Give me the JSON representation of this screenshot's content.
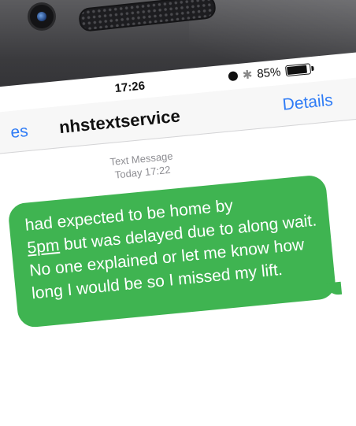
{
  "status_bar": {
    "time": "17:26",
    "battery": "85%",
    "battery_level": 0.85,
    "icons": [
      "alarm-icon",
      "bluetooth-icon",
      "battery-icon"
    ]
  },
  "nav": {
    "back_label": "es",
    "title": "nhstextservice",
    "details_label": "Details"
  },
  "thread": {
    "meta_type": "Text Message",
    "meta_time": "Today 17:22"
  },
  "message": {
    "text_prefix": "had expected to be home by",
    "link_text": "5pm",
    "text_suffix": " but was delayed due to along wait. No one explained or let me know how long I would be so I missed my lift."
  },
  "colors": {
    "bubble": "#3fb451",
    "accent": "#2f7cf6"
  }
}
